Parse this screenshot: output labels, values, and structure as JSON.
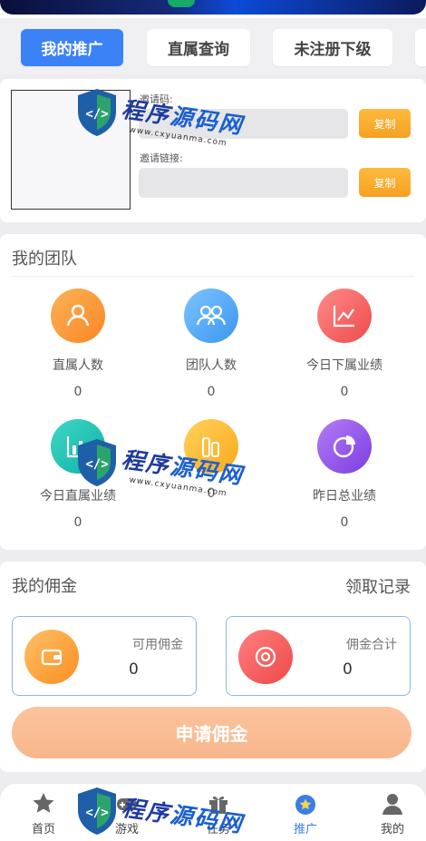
{
  "tabs": [
    {
      "label": "我的推广",
      "active": true
    },
    {
      "label": "直属查询",
      "active": false
    },
    {
      "label": "未注册下级",
      "active": false
    }
  ],
  "invite": {
    "code_label": "邀请码:",
    "link_label": "邀请链接:",
    "code_value": "",
    "link_value": "",
    "copy_label": "复制"
  },
  "team": {
    "title": "我的团队",
    "stats": [
      {
        "label": "直属人数",
        "value": "0",
        "icon": "users-icon",
        "color": "#fb9a33"
      },
      {
        "label": "团队人数",
        "value": "0",
        "icon": "group-icon",
        "color": "#4aa8f5"
      },
      {
        "label": "今日下属业绩",
        "value": "0",
        "icon": "line-chart-icon",
        "color": "#f25a5a"
      },
      {
        "label": "今日直属业绩",
        "value": "0",
        "icon": "bar-chart-icon",
        "color": "#16bfb5"
      },
      {
        "label": "",
        "value": "0",
        "icon": "coins-icon",
        "color": "#fcb52d"
      },
      {
        "label": "昨日总业绩",
        "value": "0",
        "icon": "pie-chart-icon",
        "color": "#8d4ee8"
      }
    ]
  },
  "commission": {
    "title": "我的佣金",
    "record_link": "领取记录",
    "available_label": "可用佣金",
    "available_value": "0",
    "total_label": "佣金合计",
    "total_value": "0",
    "apply_label": "申请佣金"
  },
  "tabbar": [
    {
      "label": "首页",
      "icon": "home-icon",
      "active": false
    },
    {
      "label": "游戏",
      "icon": "gamepad-icon",
      "active": false
    },
    {
      "label": "任务",
      "icon": "gift-icon",
      "active": false
    },
    {
      "label": "推广",
      "icon": "promote-icon",
      "active": true
    },
    {
      "label": "我的",
      "icon": "user-icon",
      "active": false
    }
  ],
  "watermark": {
    "text_a": "程序",
    "text_b": "源码网",
    "url": "www.cxyuanma.com"
  },
  "colors": {
    "accent": "#3b82f6",
    "copy_button": "#f6a021",
    "apply_button": "#f8b68c"
  }
}
